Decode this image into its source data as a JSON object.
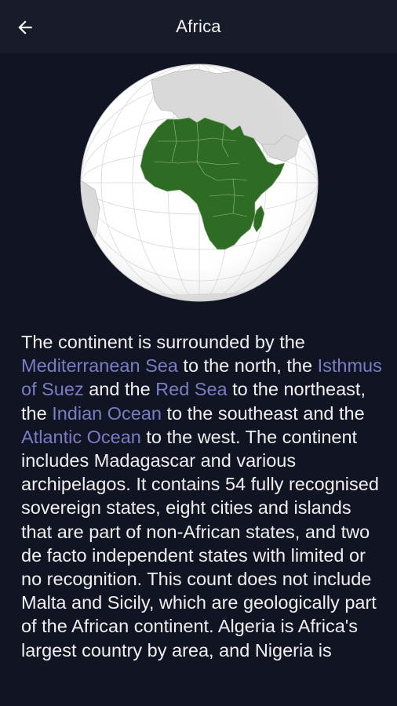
{
  "header": {
    "title": "Africa",
    "back_icon": "arrow-left-icon"
  },
  "image": {
    "subject": "orthographic-globe-africa",
    "highlight_color": "#2e6b24",
    "ocean_color": "#ffffff",
    "other_land_color": "#d9d9d9"
  },
  "article": {
    "seg1": "The continent is surrounded by the ",
    "link_mediterranean": "Mediterranean Sea",
    "seg2": " to the north, the ",
    "link_suez": "Isthmus of Suez",
    "seg3": " and the ",
    "link_red_sea": "Red Sea",
    "seg4": " to the northeast, the ",
    "link_indian": "Indian Ocean",
    "seg5": " to the southeast and the ",
    "link_atlantic": "Atlantic Ocean",
    "seg6": " to the west. The continent includes Madagascar and various archipelagos. It contains 54 fully recognised sovereign states, eight cities and islands that are part of non-African states, and two de facto independent states with limited or no recognition. This count does not include Malta and Sicily, which are geologically part of the African continent. Algeria is Africa's largest country by area, and Nigeria is"
  },
  "colors": {
    "background": "#111423",
    "appbar": "#181b29",
    "link": "#7b7dc4",
    "text": "#f0f0f0"
  }
}
